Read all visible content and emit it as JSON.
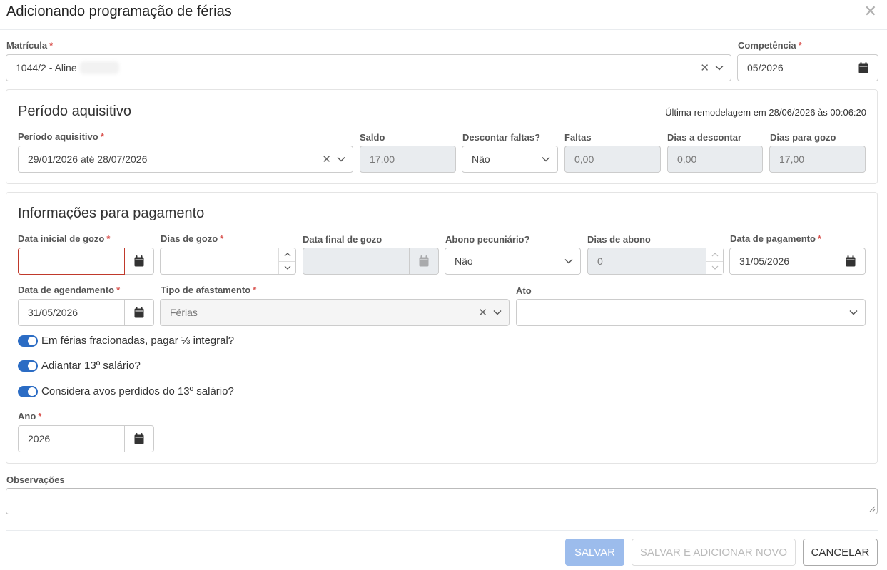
{
  "modal": {
    "title": "Adicionando programação de férias"
  },
  "top": {
    "matricula_label": "Matrícula",
    "matricula_value": "1044/2 - Aline",
    "competencia_label": "Competência",
    "competencia_value": "05/2026"
  },
  "aquisitivo": {
    "title": "Período aquisitivo",
    "last_update": "Última remodelagem em 28/06/2026 às 00:06:20",
    "periodo_label": "Período aquisitivo",
    "periodo_value": "29/01/2026 até 28/07/2026",
    "saldo_label": "Saldo",
    "saldo_value": "17,00",
    "descontar_label": "Descontar faltas?",
    "descontar_value": "Não",
    "faltas_label": "Faltas",
    "faltas_value": "0,00",
    "dias_descontar_label": "Dias a descontar",
    "dias_descontar_value": "0,00",
    "dias_gozo_label": "Dias para gozo",
    "dias_gozo_value": "17,00"
  },
  "pagamento": {
    "title": "Informações para pagamento",
    "data_inicial_label": "Data inicial de gozo",
    "data_inicial_value": "",
    "dias_gozo_label": "Dias de gozo",
    "dias_gozo_value": "",
    "data_final_label": "Data final de gozo",
    "data_final_value": "",
    "abono_label": "Abono pecuniário?",
    "abono_value": "Não",
    "dias_abono_label": "Dias de abono",
    "dias_abono_value": "0",
    "data_pagamento_label": "Data de pagamento",
    "data_pagamento_value": "31/05/2026",
    "data_agendamento_label": "Data de agendamento",
    "data_agendamento_value": "31/05/2026",
    "tipo_label": "Tipo de afastamento",
    "tipo_value": "Férias",
    "ato_label": "Ato",
    "ato_value": "",
    "toggle1": "Em férias fracionadas, pagar ⅓ integral?",
    "toggle2": "Adiantar 13º salário?",
    "toggle3": "Considera avos perdidos do 13º salário?",
    "ano_label": "Ano",
    "ano_value": "2026"
  },
  "observacoes_label": "Observações",
  "buttons": {
    "salvar": "SALVAR",
    "salvar_novo": "SALVAR E ADICIONAR NOVO",
    "cancelar": "CANCELAR"
  },
  "colors": {
    "accent": "#2b6cc4",
    "required": "#d9534f",
    "error_border": "#c0392b",
    "primary_disabled": "#9cbcec"
  },
  "icons": [
    "close-icon",
    "calendar-icon",
    "chevron-down-icon",
    "clear-icon",
    "spinner-up-icon",
    "spinner-down-icon",
    "resize-grip-icon"
  ]
}
